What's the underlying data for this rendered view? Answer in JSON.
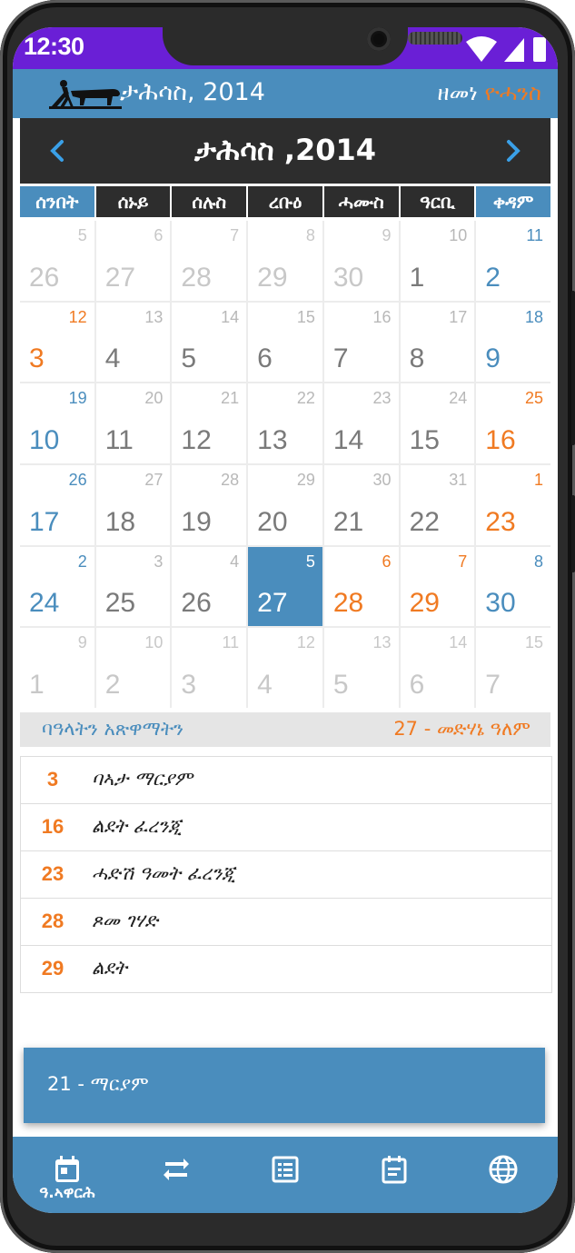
{
  "status": {
    "time": "12:30"
  },
  "app": {
    "title": "ታሕሳስ, 2014",
    "era_prefix": "ዘመነ ",
    "era_accent": "ዮሓንስ"
  },
  "calendar": {
    "month_title": "ታሕሳስ ,2014",
    "prev_icon": "chevron-left-icon",
    "next_icon": "chevron-right-icon",
    "weekdays": [
      "ሰንበት",
      "ሰኑይ",
      "ሰሉስ",
      "ረቡዕ",
      "ሓሙስ",
      "ዓርቢ",
      "ቀዳም"
    ],
    "weeks": [
      [
        {
          "big": "26",
          "small": "5",
          "state": "other"
        },
        {
          "big": "27",
          "small": "6",
          "state": "other"
        },
        {
          "big": "28",
          "small": "7",
          "state": "other"
        },
        {
          "big": "29",
          "small": "8",
          "state": "other"
        },
        {
          "big": "30",
          "small": "9",
          "state": "other"
        },
        {
          "big": "1",
          "small": "10",
          "state": "normal"
        },
        {
          "big": "2",
          "small": "11",
          "state": "blue"
        }
      ],
      [
        {
          "big": "3",
          "small": "12",
          "state": "orange"
        },
        {
          "big": "4",
          "small": "13",
          "state": "normal"
        },
        {
          "big": "5",
          "small": "14",
          "state": "normal"
        },
        {
          "big": "6",
          "small": "15",
          "state": "normal"
        },
        {
          "big": "7",
          "small": "16",
          "state": "normal"
        },
        {
          "big": "8",
          "small": "17",
          "state": "normal"
        },
        {
          "big": "9",
          "small": "18",
          "state": "blue"
        }
      ],
      [
        {
          "big": "10",
          "small": "19",
          "state": "blue"
        },
        {
          "big": "11",
          "small": "20",
          "state": "normal"
        },
        {
          "big": "12",
          "small": "21",
          "state": "normal"
        },
        {
          "big": "13",
          "small": "22",
          "state": "normal"
        },
        {
          "big": "14",
          "small": "23",
          "state": "normal"
        },
        {
          "big": "15",
          "small": "24",
          "state": "normal"
        },
        {
          "big": "16",
          "small": "25",
          "state": "orange"
        }
      ],
      [
        {
          "big": "17",
          "small": "26",
          "state": "blue"
        },
        {
          "big": "18",
          "small": "27",
          "state": "normal"
        },
        {
          "big": "19",
          "small": "28",
          "state": "normal"
        },
        {
          "big": "20",
          "small": "29",
          "state": "normal"
        },
        {
          "big": "21",
          "small": "30",
          "state": "normal"
        },
        {
          "big": "22",
          "small": "31",
          "state": "normal"
        },
        {
          "big": "23",
          "small": "1",
          "state": "orange"
        }
      ],
      [
        {
          "big": "24",
          "small": "2",
          "state": "blue"
        },
        {
          "big": "25",
          "small": "3",
          "state": "normal"
        },
        {
          "big": "26",
          "small": "4",
          "state": "normal"
        },
        {
          "big": "27",
          "small": "5",
          "state": "selected"
        },
        {
          "big": "28",
          "small": "6",
          "state": "orange"
        },
        {
          "big": "29",
          "small": "7",
          "state": "orange"
        },
        {
          "big": "30",
          "small": "8",
          "state": "blue"
        }
      ],
      [
        {
          "big": "1",
          "small": "9",
          "state": "other"
        },
        {
          "big": "2",
          "small": "10",
          "state": "other"
        },
        {
          "big": "3",
          "small": "11",
          "state": "other"
        },
        {
          "big": "4",
          "small": "12",
          "state": "other"
        },
        {
          "big": "5",
          "small": "13",
          "state": "other"
        },
        {
          "big": "6",
          "small": "14",
          "state": "other"
        },
        {
          "big": "7",
          "small": "15",
          "state": "other"
        }
      ]
    ]
  },
  "holidays": {
    "title": "ባዓላትን አጽዋማትን",
    "today_label": "27 - መድሃኔ ዓለም",
    "items": [
      {
        "num": "3",
        "name": "ባኣታ ማርያም"
      },
      {
        "num": "16",
        "name": "ልደት ፈረንጂ"
      },
      {
        "num": "23",
        "name": "ሓድሽ ዓመት ፈረንጂ"
      },
      {
        "num": "28",
        "name": "ጾመ ገሃድ"
      },
      {
        "num": "29",
        "name": "ልደት"
      }
    ]
  },
  "saint": {
    "text": "21 - ማርያም"
  },
  "bottom_nav": [
    {
      "icon": "calendar-icon",
      "label": "ዓ.ኣዋርሕ"
    },
    {
      "icon": "convert-icon",
      "label": ""
    },
    {
      "icon": "list-icon",
      "label": ""
    },
    {
      "icon": "notes-icon",
      "label": ""
    },
    {
      "icon": "globe-icon",
      "label": ""
    }
  ],
  "colors": {
    "accent_blue": "#4a8dbd",
    "accent_orange": "#f07a22",
    "status_bar": "#6a1fd6",
    "dark": "#2d2d2d"
  }
}
